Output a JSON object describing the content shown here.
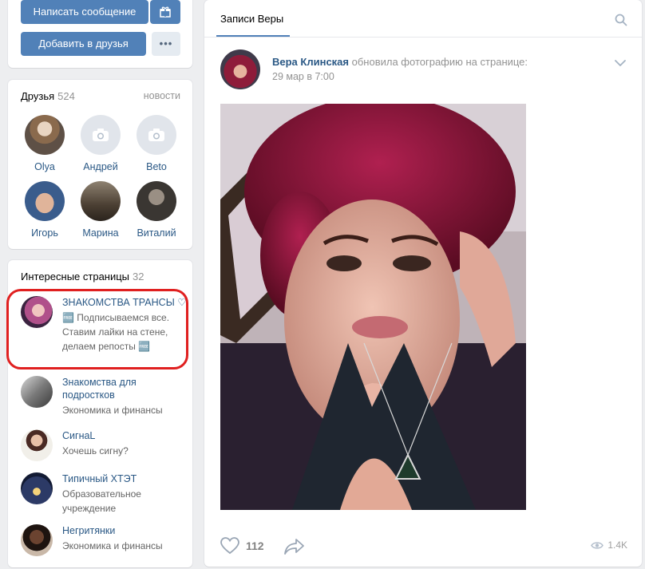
{
  "profile_actions": {
    "message_button": "Написать сообщение",
    "add_friend_button": "Добавить в друзья",
    "more_button": "•••"
  },
  "friends": {
    "title": "Друзья",
    "count": "524",
    "news_link": "новости",
    "items": [
      {
        "name": "Olya",
        "avatar": "photo"
      },
      {
        "name": "Андрей",
        "avatar": "camera-icon"
      },
      {
        "name": "Beto",
        "avatar": "camera-icon"
      },
      {
        "name": "Игорь",
        "avatar": "photo"
      },
      {
        "name": "Марина",
        "avatar": "photo"
      },
      {
        "name": "Виталий",
        "avatar": "photo"
      }
    ]
  },
  "interesting_pages": {
    "title": "Интересные страницы",
    "count": "32",
    "items": [
      {
        "title": "ЗНАКОМСТВА ТРАНСЫ ♡",
        "desc": "🆓 Подписываемся все. Ставим лайки на стене, делаем репосты 🆓"
      },
      {
        "title": "Знакомства для подростков",
        "desc": "Экономика и финансы"
      },
      {
        "title": "СигнаL",
        "desc": "Хочешь сигну?"
      },
      {
        "title": "Типичный ХТЭТ",
        "desc": "Образовательное учреждение"
      },
      {
        "title": "Негритянки",
        "desc": "Экономика и финансы"
      }
    ]
  },
  "wall": {
    "tab_label": "Записи Веры",
    "post": {
      "author": "Вера Клинская",
      "action": "обновила фотографию на странице:",
      "date": "29 мар в 7:00",
      "likes": "112",
      "views": "1.4K"
    }
  },
  "colors": {
    "accent": "#5181b8",
    "link": "#2a5885",
    "background": "#edeef0",
    "highlight": "#e02020"
  }
}
